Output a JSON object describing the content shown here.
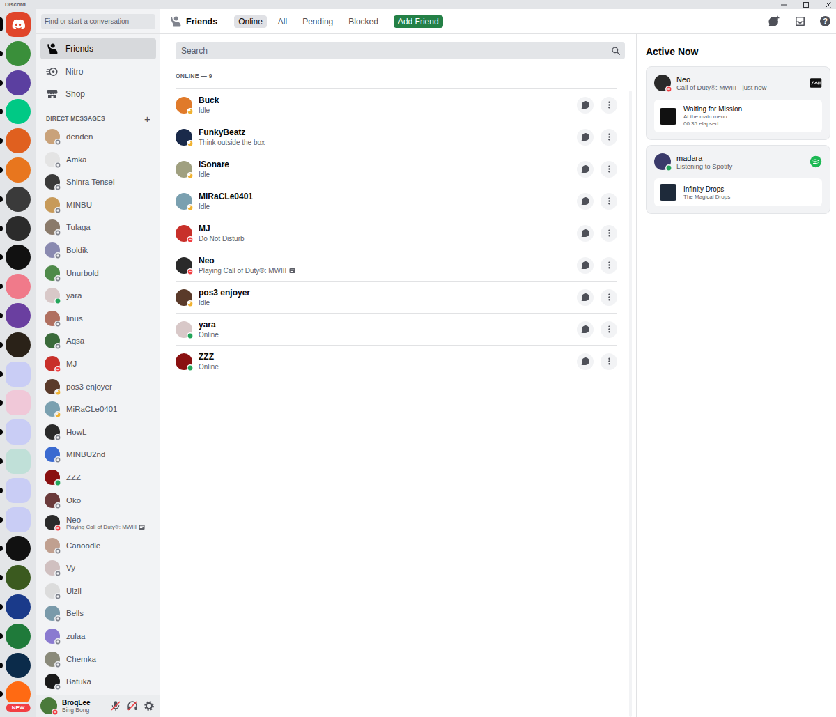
{
  "window": {
    "title": "Discord"
  },
  "servers": {
    "home": {
      "selected": true
    },
    "items": [
      {
        "kind": "server",
        "color": "#3a8f3a",
        "unread": true
      },
      {
        "kind": "server",
        "color": "#5b3fa0",
        "unread": true
      },
      {
        "kind": "server",
        "color": "#00c985",
        "unread": true
      },
      {
        "kind": "server",
        "color": "#e0601f",
        "unread": true
      },
      {
        "kind": "server",
        "color": "#e8761e",
        "unread": true
      },
      {
        "kind": "server",
        "color": "#3a3a3a",
        "unread": true
      },
      {
        "kind": "server",
        "color": "#2b2b2b",
        "unread": true
      },
      {
        "kind": "server",
        "color": "#111111",
        "unread": true
      },
      {
        "kind": "server",
        "color": "#f07a8a",
        "unread": true
      },
      {
        "kind": "server",
        "color": "#6a3fa0",
        "unread": true
      },
      {
        "kind": "server",
        "color": "#2a2218",
        "unread": true
      },
      {
        "kind": "folder",
        "color": "#c9cdf5",
        "unread": true
      },
      {
        "kind": "folder",
        "color": "#f0c8d8",
        "unread": true
      },
      {
        "kind": "folder",
        "color": "#c9cdf5",
        "unread": true
      },
      {
        "kind": "folder",
        "color": "#c0e0d8",
        "unread": true
      },
      {
        "kind": "folder",
        "color": "#c9cdf5",
        "unread": true
      },
      {
        "kind": "folder",
        "color": "#c9cdf5",
        "unread": true
      },
      {
        "kind": "server",
        "color": "#111111",
        "unread": true
      },
      {
        "kind": "server",
        "color": "#3b5a1f",
        "unread": true
      },
      {
        "kind": "server",
        "color": "#1a3a8a",
        "unread": true
      },
      {
        "kind": "server",
        "color": "#1f7a3a",
        "unread": true
      },
      {
        "kind": "server",
        "color": "#0b2b4a",
        "unread": true
      },
      {
        "kind": "server",
        "color": "#ff6a13",
        "unread": true,
        "badge": "NEW"
      }
    ]
  },
  "search": {
    "placeholder": "Find or start a conversation"
  },
  "nav": [
    {
      "label": "Friends",
      "icon": "friends",
      "selected": true
    },
    {
      "label": "Nitro",
      "icon": "nitro",
      "selected": false
    },
    {
      "label": "Shop",
      "icon": "shop",
      "selected": false
    }
  ],
  "direct_messages": {
    "header": "DIRECT MESSAGES",
    "add": "+",
    "items": [
      {
        "name": "denden",
        "status": "offline",
        "color": "#c9a27a",
        "activity_icon": false
      },
      {
        "name": "Amka",
        "status": "offline",
        "color": "#e4e4e4",
        "activity_icon": false
      },
      {
        "name": "Shinra Tensei",
        "status": "offline",
        "color": "#3a3a3a",
        "activity_icon": false
      },
      {
        "name": "MINBU",
        "status": "offline",
        "color": "#c79a5a",
        "activity_icon": false
      },
      {
        "name": "Tulaga",
        "status": "offline",
        "color": "#8a7a6a",
        "activity_icon": false
      },
      {
        "name": "Boldik",
        "status": "offline",
        "color": "#8a8ab0",
        "activity_icon": false
      },
      {
        "name": "Unurbold",
        "status": "offline",
        "color": "#4f8a4a",
        "activity_icon": false
      },
      {
        "name": "yara",
        "status": "online",
        "color": "#d8c8c8",
        "activity_icon": false
      },
      {
        "name": "linus",
        "status": "offline",
        "color": "#b07060",
        "activity_icon": false
      },
      {
        "name": "Aqsa",
        "status": "offline",
        "color": "#3a6a3a",
        "activity_icon": false
      },
      {
        "name": "MJ",
        "status": "dnd",
        "color": "#c8302a",
        "activity_icon": false
      },
      {
        "name": "pos3 enjoyer",
        "status": "idle",
        "color": "#5a3a2a",
        "activity_icon": false
      },
      {
        "name": "MiRaCLe0401",
        "status": "idle",
        "color": "#7aa0b0",
        "activity_icon": false
      },
      {
        "name": "HowL",
        "status": "offline",
        "color": "#2a2a2a",
        "activity_icon": false
      },
      {
        "name": "MINBU2nd",
        "status": "offline",
        "color": "#3a6ad0",
        "activity_icon": false
      },
      {
        "name": "ZZZ",
        "status": "online",
        "color": "#8a1010",
        "activity_icon": false
      },
      {
        "name": "Oko",
        "status": "offline",
        "color": "#6a3a3a",
        "activity_icon": false
      },
      {
        "name": "Neo",
        "status": "dnd",
        "color": "#2a2a2a",
        "subtitle": "Playing Call of Duty®: MWIII",
        "activity_icon": true
      },
      {
        "name": "Canoodle",
        "status": "offline",
        "color": "#c0a090",
        "activity_icon": false
      },
      {
        "name": "Vy",
        "status": "offline",
        "color": "#d0c0c0",
        "activity_icon": false
      },
      {
        "name": "Ulzii",
        "status": "offline",
        "color": "#dcdcdc",
        "activity_icon": false
      },
      {
        "name": "Bells",
        "status": "offline",
        "color": "#7a9aaa",
        "activity_icon": false
      },
      {
        "name": "zulaa",
        "status": "offline",
        "color": "#8a7ad0",
        "activity_icon": false
      },
      {
        "name": "Chemka",
        "status": "offline",
        "color": "#8a8a7a",
        "activity_icon": false
      },
      {
        "name": "Batuka",
        "status": "offline",
        "color": "#1a1a1a",
        "activity_icon": false
      }
    ]
  },
  "user_panel": {
    "name": "BroqLee",
    "status_text": "Bing Bong",
    "status": "dnd",
    "color": "#4a7a3a",
    "mic_muted": true,
    "deafened": true
  },
  "header": {
    "title": "Friends",
    "tabs": [
      {
        "label": "Online",
        "selected": true
      },
      {
        "label": "All",
        "selected": false
      },
      {
        "label": "Pending",
        "selected": false
      },
      {
        "label": "Blocked",
        "selected": false
      }
    ],
    "add_friend": "Add Friend",
    "help": "?"
  },
  "friends": {
    "search_placeholder": "Search",
    "section": "ONLINE — 9",
    "items": [
      {
        "name": "Buck",
        "status": "idle",
        "color": "#e07a2a",
        "status_text": "Idle",
        "activity_icon": false
      },
      {
        "name": "FunkyBeatz",
        "status": "idle",
        "color": "#1a2a4a",
        "status_text": "Think outside the box",
        "activity_icon": false
      },
      {
        "name": "iSonare",
        "status": "idle",
        "color": "#a0a080",
        "status_text": "Idle",
        "activity_icon": false
      },
      {
        "name": "MiRaCLe0401",
        "status": "idle",
        "color": "#7aa0b0",
        "status_text": "Idle",
        "activity_icon": false
      },
      {
        "name": "MJ",
        "status": "dnd",
        "color": "#c8302a",
        "status_text": "Do Not Disturb",
        "activity_icon": false
      },
      {
        "name": "Neo",
        "status": "dnd",
        "color": "#2a2a2a",
        "status_text": "Playing Call of Duty®: MWIII",
        "activity_icon": true
      },
      {
        "name": "pos3 enjoyer",
        "status": "idle",
        "color": "#5a3a2a",
        "status_text": "Idle",
        "activity_icon": false
      },
      {
        "name": "yara",
        "status": "online",
        "color": "#d8c8c8",
        "status_text": "Online",
        "activity_icon": false
      },
      {
        "name": "ZZZ",
        "status": "online",
        "color": "#8a1010",
        "status_text": "Online",
        "activity_icon": false
      }
    ]
  },
  "active_now": {
    "title": "Active Now",
    "cards": [
      {
        "name": "Neo",
        "status": "dnd",
        "color": "#2a2a2a",
        "subtitle": "Call of Duty®: MWIII - just now",
        "kind": "game",
        "detail": {
          "title": "Waiting for Mission",
          "lines": [
            "At the main menu",
            "00:35 elapsed"
          ]
        }
      },
      {
        "name": "madara",
        "status": "online",
        "color": "#3a3a6a",
        "subtitle": "Listening to Spotify",
        "kind": "spotify",
        "detail": {
          "title": "Infinity Drops",
          "lines": [
            "The Magical Drops"
          ]
        }
      }
    ]
  }
}
